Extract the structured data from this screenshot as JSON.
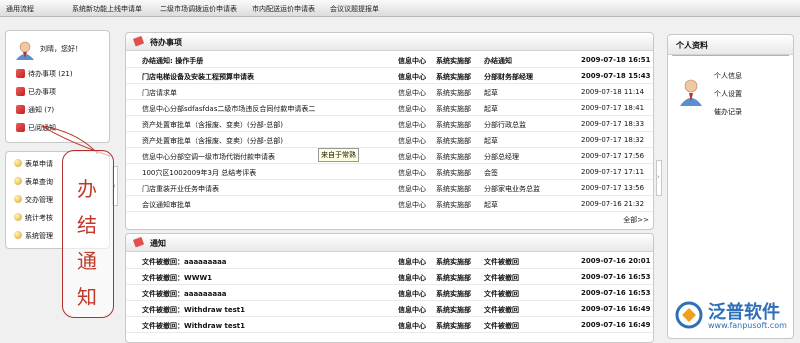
{
  "topbar": {
    "items": [
      "通用流程",
      "系统新功能上线申请单",
      "二级市场调拨运价申请表",
      "市内配送运价申请表",
      "会议议题提报单"
    ]
  },
  "user": {
    "greeting": "刘晴，您好！",
    "items": [
      {
        "label": "待办事项",
        "count": "(21)",
        "icon": "todo-icon"
      },
      {
        "label": "已办事项",
        "count": "",
        "icon": "done-icon"
      },
      {
        "label": "通知",
        "count": "(7)",
        "icon": "notice-icon"
      },
      {
        "label": "已阅通知",
        "count": "",
        "icon": "read-notice-icon"
      }
    ]
  },
  "menu": {
    "items": [
      "表单申请",
      "表单查询",
      "交办管理",
      "统计考核",
      "系统管理"
    ]
  },
  "annotation": {
    "chars": [
      "办",
      "结",
      "通",
      "知"
    ]
  },
  "todo": {
    "title": "待办事项",
    "more": "全部>>",
    "tooltip": "来自于常熟",
    "rows": [
      {
        "title": "办结通知: 操作手册",
        "center": "信息中心",
        "dept": "系统实施部",
        "step": "办结通知",
        "time": "2009-07-18 16:51",
        "bold": true
      },
      {
        "title": "门店电梯设备及安装工程预算申请表",
        "center": "信息中心",
        "dept": "系统实施部",
        "step": "分部财务部经理",
        "time": "2009-07-18 15:43",
        "bold": true
      },
      {
        "title": "门店请求单",
        "center": "信息中心",
        "dept": "系统实施部",
        "step": "起草",
        "time": "2009-07-18 11:14",
        "bold": false
      },
      {
        "title": "信息中心分部sdfasfdas二级市场违反合同付款申请表二",
        "center": "信息中心",
        "dept": "系统实施部",
        "step": "起草",
        "time": "2009-07-17 18:41",
        "bold": false
      },
      {
        "title": "资产处置审批单（含报废、变卖）(分部-总部)",
        "center": "信息中心",
        "dept": "系统实施部",
        "step": "分部行政总监",
        "time": "2009-07-17 18:33",
        "bold": false
      },
      {
        "title": "资产处置审批单（含报废、变卖）(分部-总部)",
        "center": "信息中心",
        "dept": "系统实施部",
        "step": "起草",
        "time": "2009-07-17 18:32",
        "bold": false
      },
      {
        "title": "信息中心分部空调一级市场代销付款申请表",
        "center": "信息中心",
        "dept": "系统实施部",
        "step": "分部总经理",
        "time": "2009-07-17 17:56",
        "bold": false
      },
      {
        "title": "100穴区1002009年3月 总结考评表",
        "center": "信息中心",
        "dept": "系统实施部",
        "step": "会签",
        "time": "2009-07-17 17:11",
        "bold": false
      },
      {
        "title": "门店重装开业任务申请表",
        "center": "信息中心",
        "dept": "系统实施部",
        "step": "分部家电业务总监",
        "time": "2009-07-17 13:56",
        "bold": false
      },
      {
        "title": "会议通知审批单",
        "center": "信息中心",
        "dept": "系统实施部",
        "step": "起草",
        "time": "2009-07-16 21:32",
        "bold": false
      }
    ]
  },
  "notice": {
    "title": "通知",
    "rows": [
      {
        "title": "文件被撤回：aaaaaaaaa",
        "center": "信息中心",
        "dept": "系统实施部",
        "step": "文件被撤回",
        "time": "2009-07-16 20:01"
      },
      {
        "title": "文件被撤回：WWW1",
        "center": "信息中心",
        "dept": "系统实施部",
        "step": "文件被撤回",
        "time": "2009-07-16 16:53"
      },
      {
        "title": "文件被撤回：aaaaaaaaa",
        "center": "信息中心",
        "dept": "系统实施部",
        "step": "文件被撤回",
        "time": "2009-07-16 16:53"
      },
      {
        "title": "文件被撤回：Withdraw test1",
        "center": "信息中心",
        "dept": "系统实施部",
        "step": "文件被撤回",
        "time": "2009-07-16 16:49"
      },
      {
        "title": "文件被撤回：Withdraw test1",
        "center": "信息中心",
        "dept": "系统实施部",
        "step": "文件被撤回",
        "time": "2009-07-16 16:49"
      }
    ]
  },
  "profile": {
    "title": "个人资料",
    "links": [
      "个人信息",
      "个人设置",
      "催办记录"
    ]
  },
  "watermark": {
    "brand": "泛普软件",
    "url": "www.fanpusoft.com"
  },
  "colors": {
    "annotation": "#c0392b",
    "brand": "#2e6fb8"
  }
}
